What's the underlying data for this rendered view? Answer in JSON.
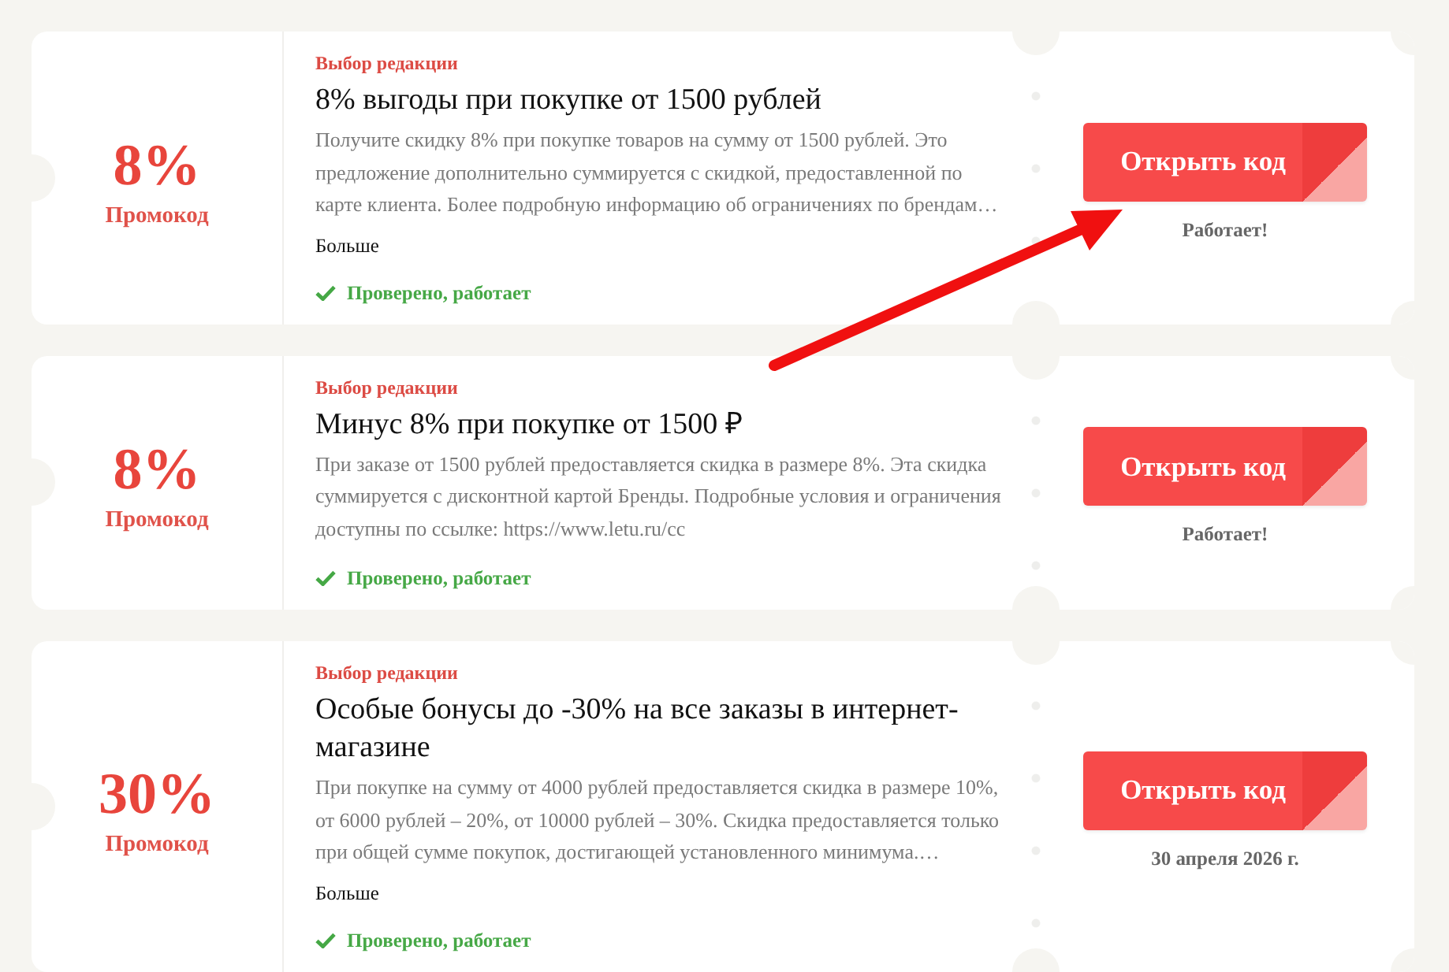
{
  "offers": [
    {
      "discount": "8%",
      "discount_label": "Промокод",
      "badge": "Выбор редакции",
      "title": "8% выгоды при покупке от 1500 рублей",
      "description": "Получите скидку 8% при покупке товаров на сумму от 1500 рублей. Это предложение дополнительно суммируется с скидкой, предоставленной по карте клиента. Более подробную информацию об ограничениях по брендам…",
      "more_link": "Больше",
      "verified": "Проверено, работает",
      "button": "Открыть код",
      "note": "Работает!"
    },
    {
      "discount": "8%",
      "discount_label": "Промокод",
      "badge": "Выбор редакции",
      "title": "Минус 8% при покупке от 1500 ₽",
      "description": "При заказе от 1500 рублей предоставляется скидка в размере 8%. Эта скидка суммируется с дисконтной картой Бренды. Подробные условия и ограничения доступны по ссылке: https://www.letu.ru/cc",
      "verified": "Проверено, работает",
      "button": "Открыть код",
      "note": "Работает!"
    },
    {
      "discount": "30%",
      "discount_label": "Промокод",
      "badge": "Выбор редакции",
      "title": "Особые бонусы до -30% на все заказы в интернет-магазине",
      "description": "При покупке на сумму от 4000 рублей предоставляется скидка в размере 10%, от 6000 рублей – 20%, от 10000 рублей – 30%. Скидка предоставляется только при общей сумме покупок, достигающей установленного минимума.…",
      "more_link": "Больше",
      "verified": "Проверено, работает",
      "button": "Открыть код",
      "note": "30 апреля 2026 г."
    }
  ]
}
